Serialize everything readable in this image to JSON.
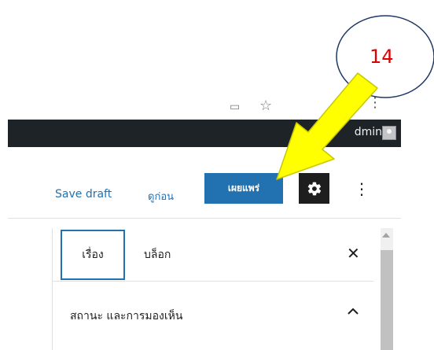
{
  "admin_bar": {
    "greeting": "dmin"
  },
  "toolbar": {
    "save_draft": "Save draft",
    "preview": "ดูก่อน",
    "publish": "เผยแพร่",
    "settings_icon": "gear-icon",
    "more_icon": "vertical-ellipsis-icon"
  },
  "sidebar": {
    "tabs": [
      {
        "label": "เรื่อง"
      },
      {
        "label": "บล็อก"
      }
    ],
    "panel_title": "สถานะ และการมองเห็น"
  },
  "annotation": {
    "step_number": "14",
    "callout_stroke": "#1f3864",
    "arrow_fill": "#ffff00",
    "arrow_stroke": "#c7c700"
  },
  "colors": {
    "admin_bar": "#1d2327",
    "accent": "#2271b1",
    "settings_button": "#1e1e1e"
  }
}
